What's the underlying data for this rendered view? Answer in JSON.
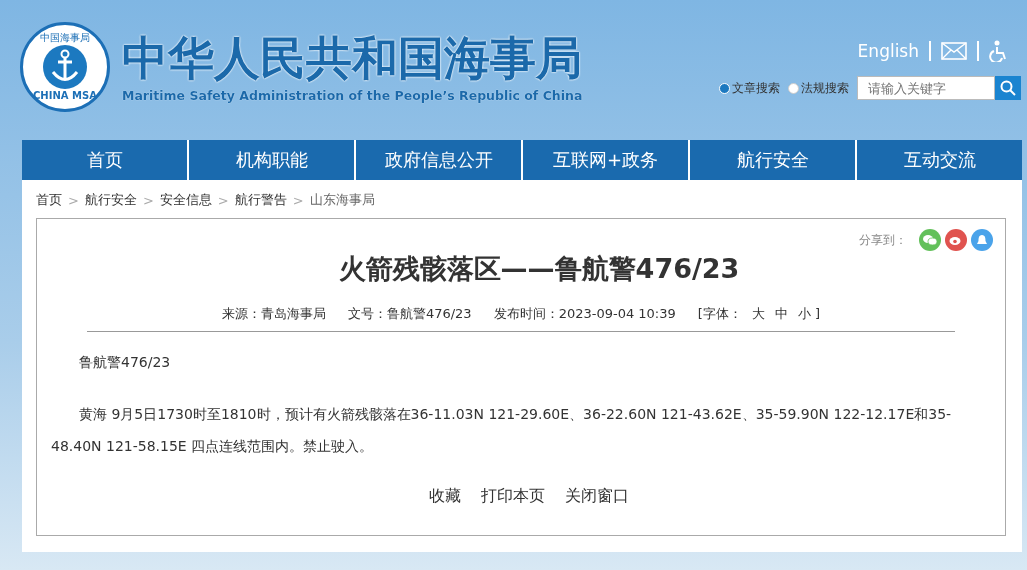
{
  "header": {
    "logo": {
      "top_text": "中国海事局",
      "bottom_text": "CHINA MSA"
    },
    "title": "中华人民共和国海事局",
    "subtitle": "Maritime Safety Administration of the People’s Republic of China",
    "links": [
      {
        "label": "English"
      }
    ],
    "search": {
      "options": [
        {
          "label": "文章搜索",
          "selected": true
        },
        {
          "label": "法规搜索",
          "selected": false
        }
      ],
      "placeholder": "请输入关键字"
    }
  },
  "nav": [
    {
      "label": "首页"
    },
    {
      "label": "机构职能"
    },
    {
      "label": "政府信息公开"
    },
    {
      "label": "互联网+政务"
    },
    {
      "label": "航行安全"
    },
    {
      "label": "互动交流"
    }
  ],
  "breadcrumb": {
    "separator": ">",
    "items": [
      "首页",
      "航行安全",
      "安全信息",
      "航行警告",
      "山东海事局"
    ]
  },
  "article": {
    "share_label": "分享到：",
    "title": "火箭残骸落区——鲁航警476/23",
    "meta": [
      {
        "text": "来源：青岛海事局"
      },
      {
        "text": "文号：鲁航警476/23"
      },
      {
        "text": "发布时间：2023-09-04 10:39"
      }
    ],
    "font_label": "[字体：",
    "font_sizes": [
      "大",
      "中",
      "小 ]"
    ],
    "paragraphs": [
      "鲁航警476/23",
      "黄海  9月5日1730时至1810时，预计有火箭残骸落在36-11.03N 121-29.60E、36-22.60N 121-43.62E、35-59.90N 122-12.17E和35-48.40N 121-58.15E 四点连线范围内。禁止驶入。"
    ],
    "actions": [
      "收藏",
      "打印本页",
      "关闭窗口"
    ]
  }
}
